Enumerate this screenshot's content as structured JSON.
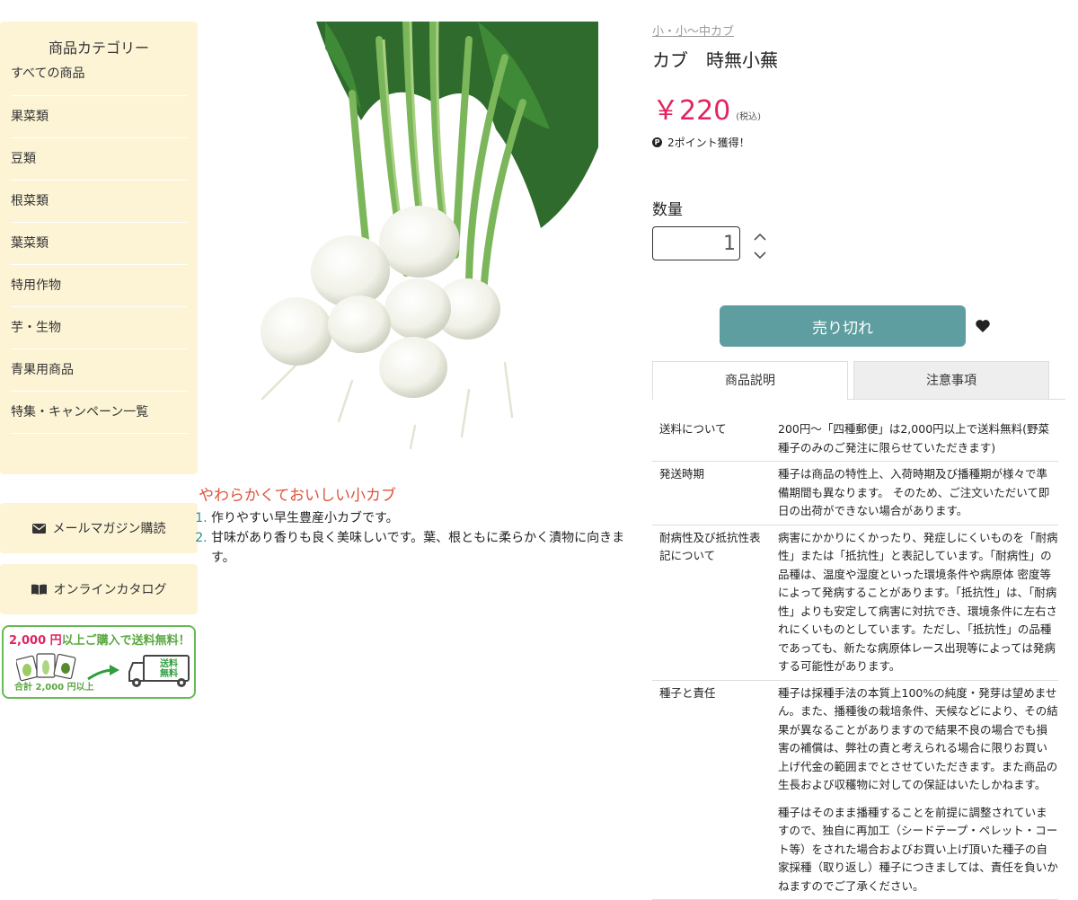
{
  "sidebar": {
    "category_title": "商品カテゴリー",
    "categories": [
      "すべての商品",
      "果菜類",
      "豆類",
      "根菜類",
      "葉菜類",
      "特用作物",
      "芋・生物",
      "青果用商品",
      "特集・キャンペーン一覧"
    ],
    "newsletter_label": "メールマガジン購読",
    "catalog_label": "オンラインカタログ",
    "banner": {
      "amount": "2,000 円",
      "text": "以上ご購入で送料無料！",
      "total": "合計 2,000 円以上",
      "truck_text_1": "送料",
      "truck_text_2": "無料"
    }
  },
  "product": {
    "breadcrumb": "小・小〜中カブ",
    "name": "カブ　時無小蕪",
    "price": "￥220",
    "tax_note": "(税込)",
    "points": "2ポイント獲得！",
    "quantity_label": "数量",
    "quantity_value": "1",
    "soldout_label": "売り切れ",
    "description_title": "やわらかくておいしい小カブ",
    "features": [
      "作りやすい早生豊産小カブです。",
      "甘味があり香りも良く美味しいです。葉、根ともに柔らかく漬物に向きます。"
    ]
  },
  "tabs": [
    "商品説明",
    "注意事項"
  ],
  "spec_rows": [
    {
      "key": "送料について",
      "value": [
        "200円〜「四種郵便」は2,000円以上で送料無料(野菜種子のみのご発注に限らせていただきます)"
      ]
    },
    {
      "key": "発送時期",
      "value": [
        "種子は商品の特性上、入荷時期及び播種期が様々で準備期間も異なります。 そのため、ご注文いただいて即日の出荷ができない場合があります。"
      ]
    },
    {
      "key": "耐病性及び抵抗性表記について",
      "value": [
        "病害にかかりにくかったり、発症しにくいものを「耐病性」または「抵抗性」と表記しています。「耐病性」の品種は、温度や湿度といった環境条件や病原体 密度等によって発病することがあります。「抵抗性」は、「耐病性」よりも安定して病害に対抗でき、環境条件に左右されにくいものとしています。ただし、「抵抗性」の品種であっても、新たな病原体レース出現等によっては発病する可能性があります。"
      ]
    },
    {
      "key": "種子と責任",
      "value": [
        "種子は採種手法の本質上100%の純度・発芽は望めません。また、播種後の栽培条件、天候などにより、その結果が異なることがありますので結果不良の場合でも損害の補償は、弊社の責と考えられる場合に限りお買い上げ代金の範囲までとさせていただきます。また商品の生長および収穫物に対しての保証はいたしかねます。",
        "種子はそのまま播種することを前提に調整されていますので、独自に再加工（シードテープ・ペレット・コート等）をされた場合およびお買い上げ頂いた種子の自家採種（取り返し）種子につきましては、責任を負いかねますのでご了承ください。"
      ]
    }
  ],
  "colors": {
    "sidebar_bg": "#fdf4d6",
    "price": "#e0245e",
    "accent_teal": "#5f9ea0",
    "title_red": "#e0533a",
    "banner_green": "#66bb55"
  }
}
